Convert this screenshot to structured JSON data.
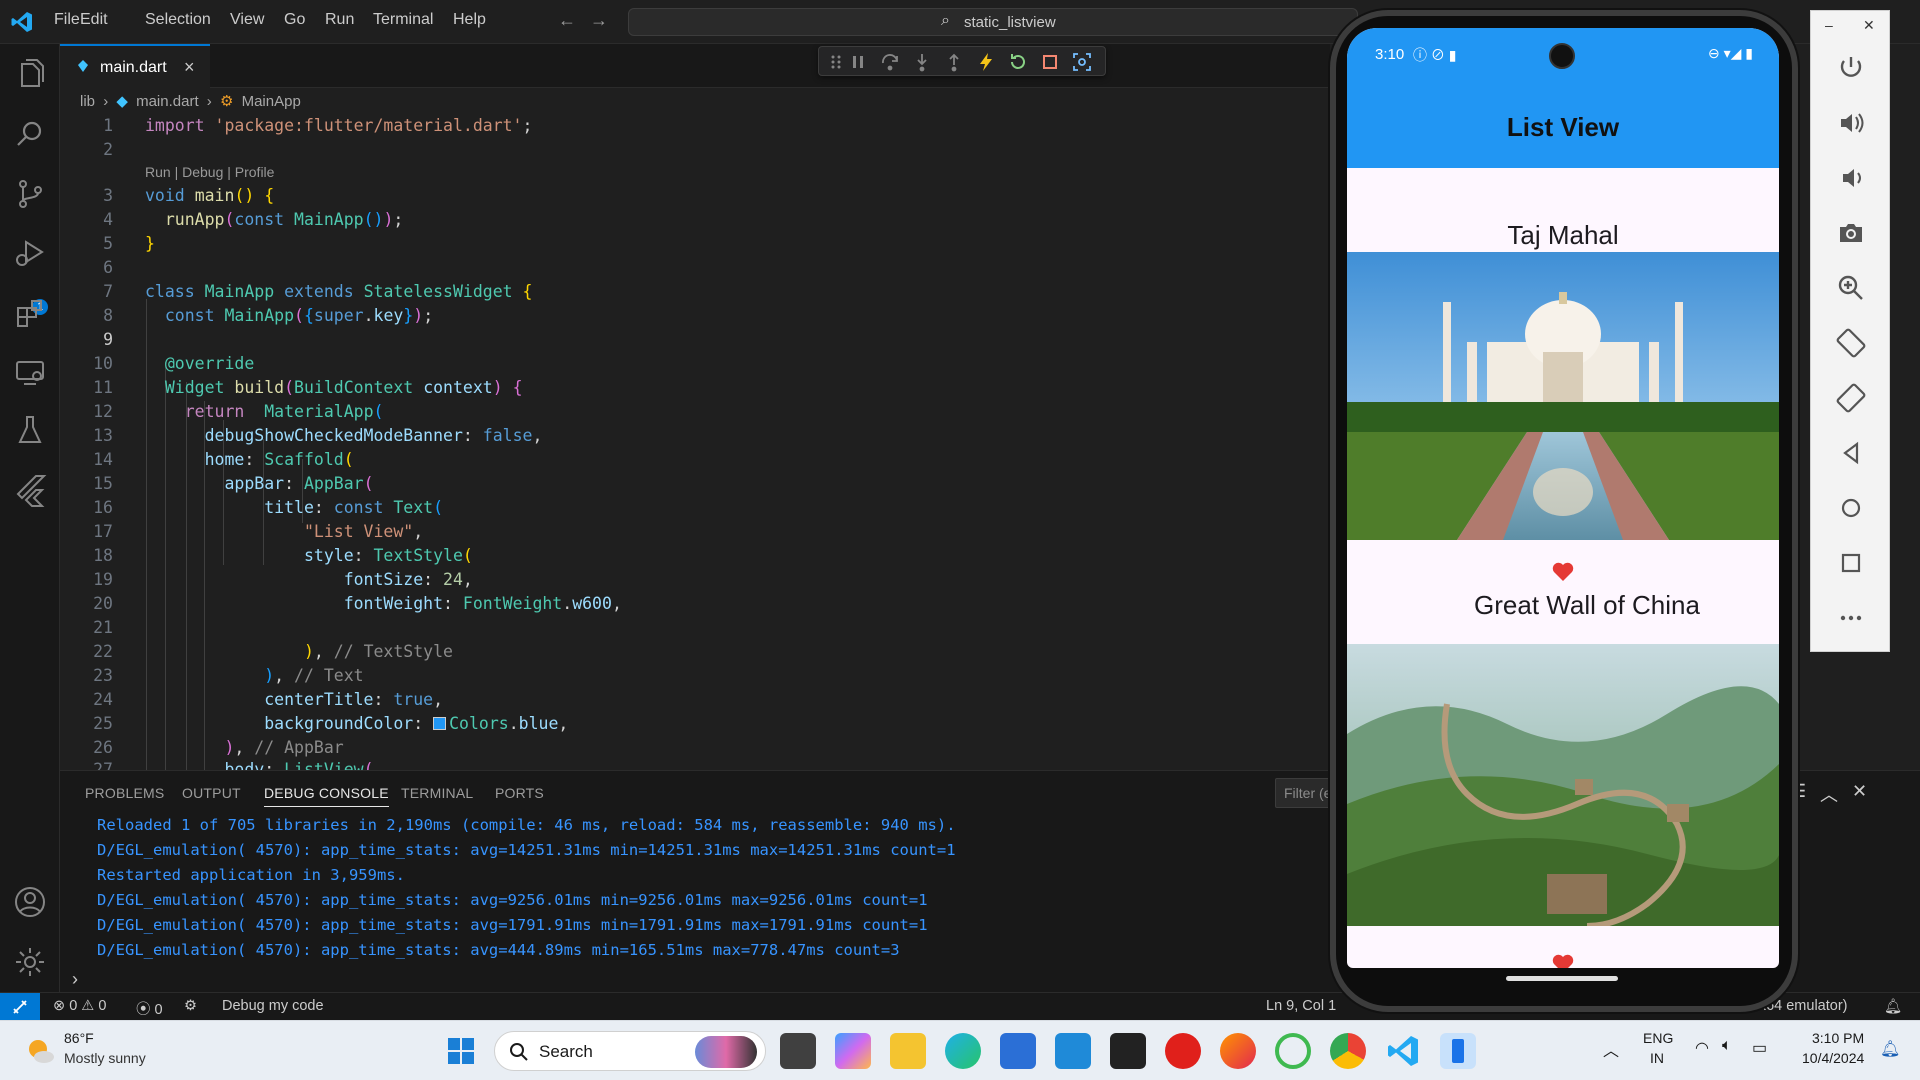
{
  "menu": [
    "File",
    "Edit",
    "Selection",
    "View",
    "Go",
    "Run",
    "Terminal",
    "Help"
  ],
  "command_center": "static_listview",
  "tab": {
    "label": "main.dart",
    "close": "×"
  },
  "breadcrumb": [
    "lib",
    "main.dart",
    "MainApp"
  ],
  "code_lens": "Run | Debug | Profile",
  "line_numbers": [
    "1",
    "2",
    "3",
    "4",
    "5",
    "6",
    "7",
    "8",
    "9",
    "10",
    "11",
    "12",
    "13",
    "14",
    "15",
    "16",
    "17",
    "18",
    "19",
    "20",
    "21",
    "22",
    "23",
    "24",
    "25",
    "26",
    "27"
  ],
  "code": {
    "l1_kw": "import",
    "l1_str": "'package:flutter/material.dart'",
    "l3_kw": "void",
    "l3_fn": "main",
    "l4_fn": "runApp",
    "l4_kw": "const",
    "l4_type": "MainApp",
    "l7_kw1": "class",
    "l7_type": "MainApp",
    "l7_kw2": "extends",
    "l7_type2": "StatelessWidget",
    "l8_kw": "const",
    "l8_type": "MainApp",
    "l8_super": "super",
    "l8_key": "key",
    "l10_anno": "@override",
    "l11_type": "Widget",
    "l11_fn": "build",
    "l11_ptype": "BuildContext",
    "l11_param": "context",
    "l12_kw": "return",
    "l12_type": "MaterialApp",
    "l13_prop": "debugShowCheckedModeBanner",
    "l13_val": "false",
    "l14_prop": "home",
    "l14_type": "Scaffold",
    "l15_prop": "appBar",
    "l15_type": "AppBar",
    "l16_prop": "title",
    "l16_kw": "const",
    "l16_type": "Text",
    "l17_str": "\"List View\"",
    "l18_prop": "style",
    "l18_type": "TextStyle",
    "l19_prop": "fontSize",
    "l19_val": "24",
    "l20_prop": "fontWeight",
    "l20_type": "FontWeight",
    "l20_val": "w600",
    "l22_cm": "// TextStyle",
    "l23_cm": "// Text",
    "l24_prop": "centerTitle",
    "l24_val": "true",
    "l25_prop": "backgroundColor",
    "l25_type": "Colors",
    "l25_val": "blue",
    "l26_cm": "// AppBar",
    "l27_prop": "body",
    "l27_type": "ListView"
  },
  "panel": {
    "tabs": [
      "PROBLEMS",
      "OUTPUT",
      "DEBUG CONSOLE",
      "TERMINAL",
      "PORTS"
    ],
    "filter_placeholder": "Filter (e",
    "console": [
      "Reloaded 1 of 705 libraries in 2,190ms (compile: 46 ms, reload: 584 ms, reassemble: 940 ms).",
      "D/EGL_emulation( 4570): app_time_stats: avg=14251.31ms min=14251.31ms max=14251.31ms count=1",
      "Restarted application in 3,959ms.",
      "D/EGL_emulation( 4570): app_time_stats: avg=9256.01ms min=9256.01ms max=9256.01ms count=1",
      "D/EGL_emulation( 4570): app_time_stats: avg=1791.91ms min=1791.91ms max=1791.91ms count=1",
      "D/EGL_emulation( 4570): app_time_stats: avg=444.89ms min=165.51ms max=778.47ms count=3"
    ]
  },
  "statusbar": {
    "errors": "0",
    "warnings": "0",
    "ports": "0",
    "debug": "Debug my code",
    "position": "Ln 9, Col 1",
    "device": "-x64 emulator)"
  },
  "phone": {
    "time": "3:10",
    "appbar_title": "List View",
    "items": [
      "Taj Mahal",
      "Great Wall of China"
    ],
    "accent": "#2196f3"
  },
  "taskbar": {
    "weather_temp": "86°F",
    "weather_desc": "Mostly sunny",
    "search": "Search",
    "lang1": "ENG",
    "lang2": "IN",
    "time": "3:10 PM",
    "date": "10/4/2024"
  }
}
